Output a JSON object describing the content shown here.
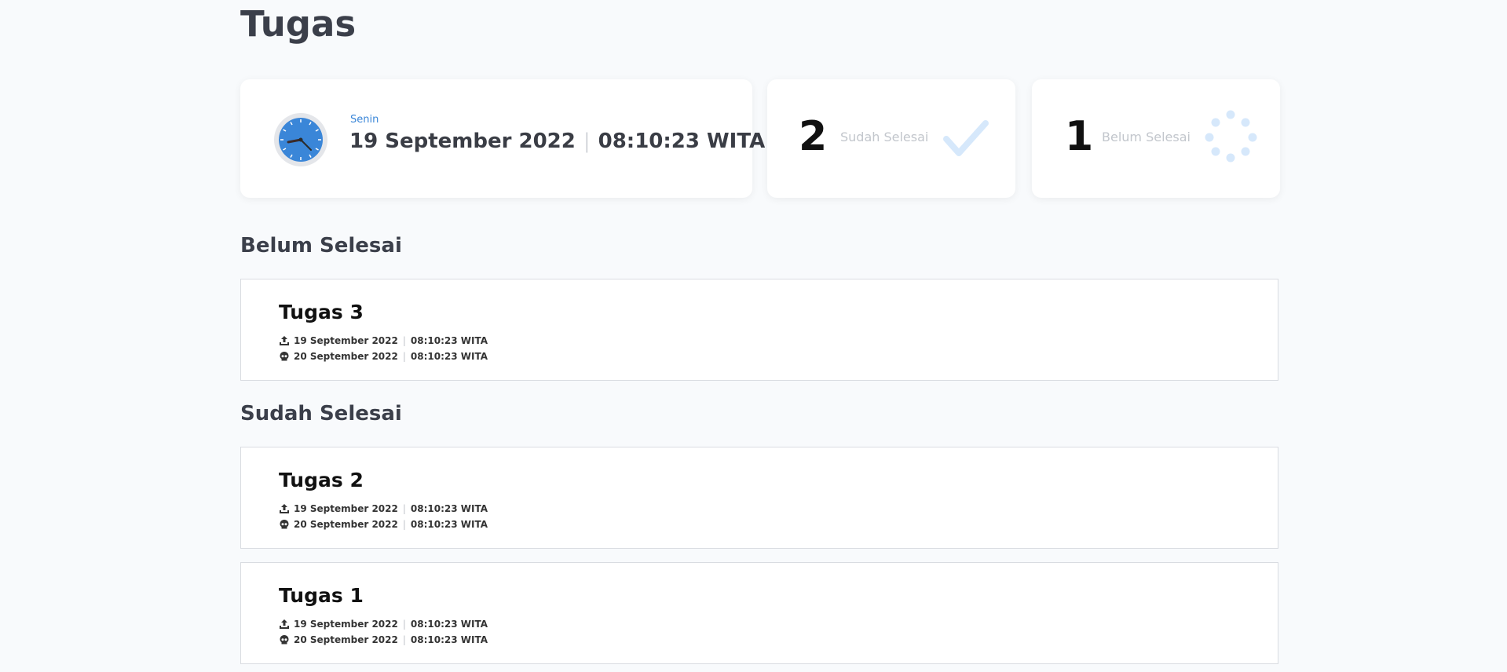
{
  "page": {
    "title": "Tugas"
  },
  "date_card": {
    "day": "Senin",
    "date": "19 September 2022",
    "time": "08:10:23 WITA"
  },
  "stats": {
    "done": {
      "count": "2",
      "label": "Sudah Selesai",
      "icon": "check-icon"
    },
    "pending": {
      "count": "1",
      "label": "Belum Selesai",
      "icon": "loading-dots-icon"
    }
  },
  "sections": {
    "pending_title": "Belum Selesai",
    "done_title": "Sudah Selesai"
  },
  "tasks": [
    {
      "title": "Tugas 3",
      "upload_date": "19 September 2022",
      "upload_time": "08:10:23 WITA",
      "deadline_date": "20 September 2022",
      "deadline_time": "08:10:23 WITA"
    },
    {
      "title": "Tugas 2",
      "upload_date": "19 September 2022",
      "upload_time": "08:10:23 WITA",
      "deadline_date": "20 September 2022",
      "deadline_time": "08:10:23 WITA"
    },
    {
      "title": "Tugas 1",
      "upload_date": "19 September 2022",
      "upload_time": "08:10:23 WITA",
      "deadline_date": "20 September 2022",
      "deadline_time": "08:10:23 WITA"
    }
  ],
  "colors": {
    "accent": "#3a86d8",
    "check": "#d6e8fb",
    "dots": "#d6e8fb"
  }
}
